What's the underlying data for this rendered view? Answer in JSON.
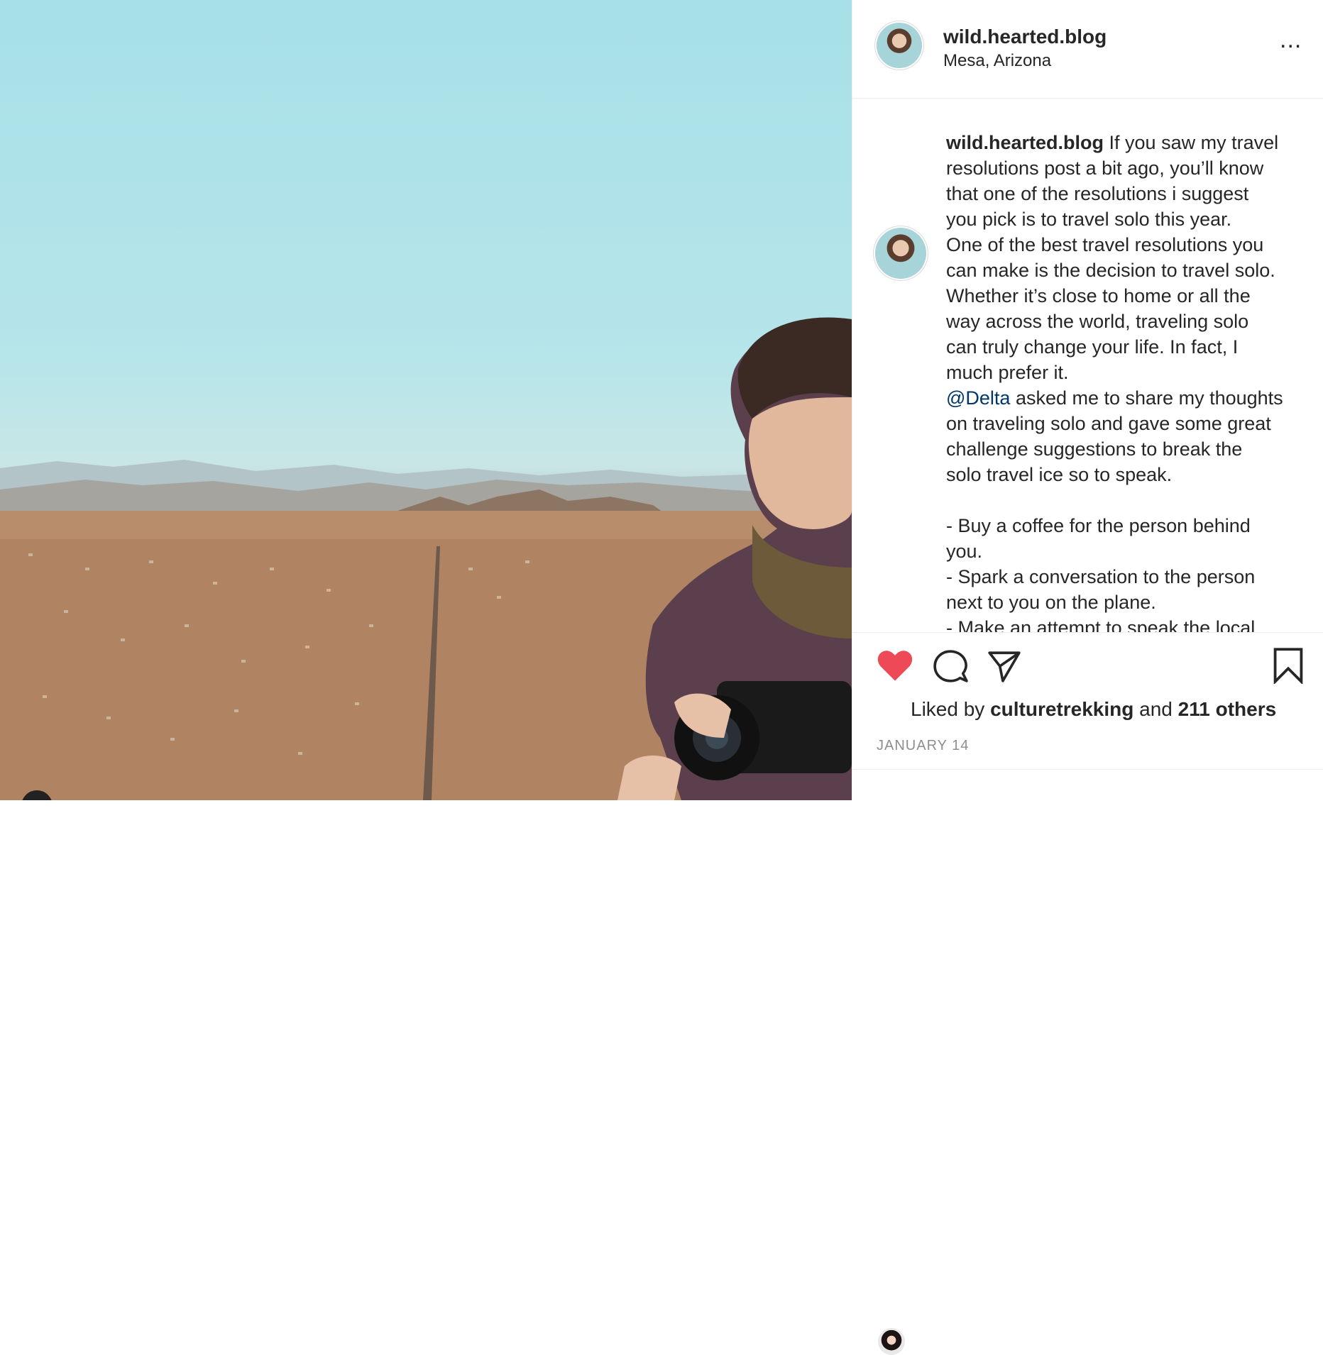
{
  "post": {
    "username": "wild.hearted.blog",
    "location": "Mesa, Arizona",
    "more_label": "...",
    "caption_lines": "If you saw my travel\nresolutions post a bit ago, you’ll know\nthat one of the resolutions i suggest\nyou pick is to travel solo this year.\nOne of the best travel resolutions you\ncan make is the decision to travel solo.\nWhether it’s close to home or all the\nway across the world, traveling solo\ncan truly change your life.   In fact, I\nmuch prefer it.",
    "mention": "@Delta",
    "caption_after_mention": " asked me to share my thoughts\non traveling solo and gave some great\nchallenge suggestions to break the\nsolo travel ice so to speak.\n\n- Buy a coffee for the person behind\nyou.\n- Spark a conversation to the person\nnext to you on the plane.\n- Make an attempt to speak the local"
  },
  "likes": {
    "prefix": "Liked by ",
    "user": "culturetrekking",
    "middle": " and ",
    "others": "211 others"
  },
  "date": "JANUARY 14",
  "icons": {
    "like": "heart-icon",
    "comment": "comment-icon",
    "share": "paper-plane-icon",
    "save": "bookmark-icon",
    "more": "more-horizontal-icon"
  },
  "colors": {
    "liked_heart": "#ed4956",
    "mention": "#00376b",
    "muted": "#8e8e8e"
  }
}
